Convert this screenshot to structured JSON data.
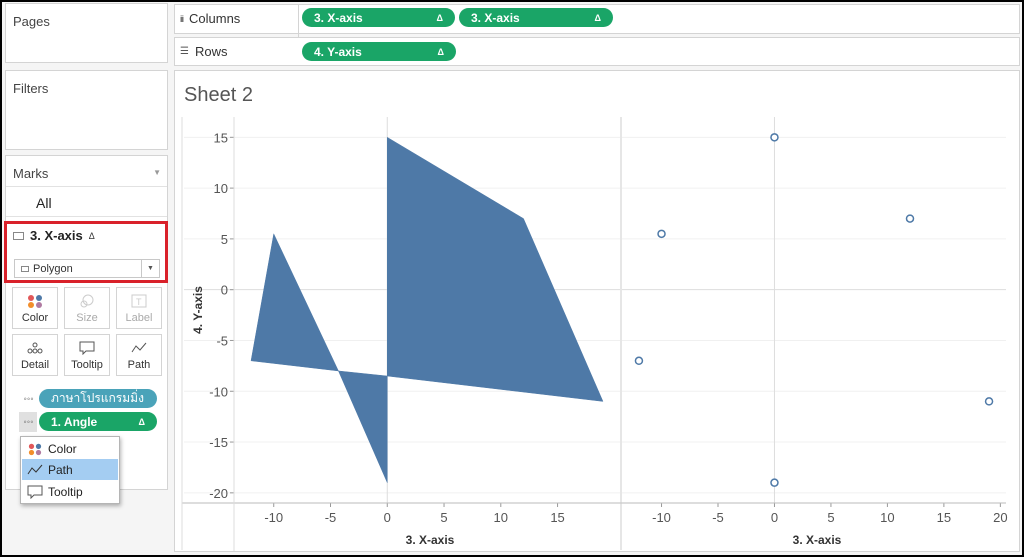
{
  "left_panel": {
    "pages_title": "Pages",
    "filters_title": "Filters",
    "marks": {
      "title": "Marks",
      "all_label": "All",
      "card_label": "3. X-axis",
      "card_delta": "Δ",
      "mark_type": "Polygon",
      "buttons": [
        {
          "label": "Color",
          "icon": "color-dots-icon",
          "enabled": true
        },
        {
          "label": "Size",
          "icon": "size-icon",
          "enabled": false
        },
        {
          "label": "Label",
          "icon": "label-icon",
          "enabled": false
        },
        {
          "label": "Detail",
          "icon": "detail-dots-icon",
          "enabled": true
        },
        {
          "label": "Tooltip",
          "icon": "tooltip-icon",
          "enabled": true
        },
        {
          "label": "Path",
          "icon": "path-line-icon",
          "enabled": true
        }
      ],
      "fields": [
        {
          "label": "ภาษาโปรแกรมมิ่ง",
          "color": "#4aa3b9"
        },
        {
          "label": "1. Angle",
          "delta": "Δ",
          "color": "#1aa567"
        }
      ],
      "dropdown": {
        "items": [
          {
            "label": "Color",
            "icon": "color-dots-icon"
          },
          {
            "label": "Path",
            "icon": "path-line-icon",
            "selected": true
          },
          {
            "label": "Tooltip",
            "icon": "tooltip-icon"
          }
        ]
      }
    }
  },
  "shelves": {
    "columns": {
      "label": "Columns",
      "icon": "columns-icon",
      "pills": [
        {
          "label": "3. X-axis",
          "delta": "Δ"
        },
        {
          "label": "3. X-axis",
          "delta": "Δ"
        }
      ]
    },
    "rows": {
      "label": "Rows",
      "icon": "rows-icon",
      "pills": [
        {
          "label": "4. Y-axis",
          "delta": "Δ"
        }
      ]
    }
  },
  "sheet": {
    "title": "Sheet 2"
  },
  "colors": {
    "pill_green": "#1aa567",
    "pill_teal": "#4aa3b9",
    "mark_blue": "#4e79a7",
    "highlight_red": "#d9212a"
  },
  "chart_data": [
    {
      "type": "area",
      "mark": "polygon",
      "xlabel": "3. X-axis",
      "ylabel": "4. Y-axis",
      "xlim": [
        -13.5,
        20.5
      ],
      "ylim": [
        -21,
        17
      ],
      "xticks": [
        -10,
        -5,
        0,
        5,
        10,
        15
      ],
      "yticks": [
        15,
        10,
        5,
        0,
        -5,
        -10,
        -15,
        -20
      ],
      "polygons": [
        [
          [
            -10,
            5.5
          ],
          [
            -12,
            -7
          ],
          [
            -4.3,
            -8
          ],
          [
            0,
            -19
          ],
          [
            0,
            15
          ],
          [
            12,
            7
          ],
          [
            19,
            -11
          ],
          [
            0,
            -8.5
          ],
          [
            -4.3,
            -8
          ]
        ]
      ]
    },
    {
      "type": "scatter",
      "xlabel": "3. X-axis",
      "xlim": [
        -13.5,
        20.5
      ],
      "ylim": [
        -21,
        17
      ],
      "xticks": [
        -10,
        -5,
        0,
        5,
        10,
        15,
        20
      ],
      "points": [
        {
          "x": -10,
          "y": 5.5
        },
        {
          "x": -12,
          "y": -7
        },
        {
          "x": 0,
          "y": 15
        },
        {
          "x": 0,
          "y": -19
        },
        {
          "x": 12,
          "y": 7
        },
        {
          "x": 19,
          "y": -11
        }
      ]
    }
  ]
}
